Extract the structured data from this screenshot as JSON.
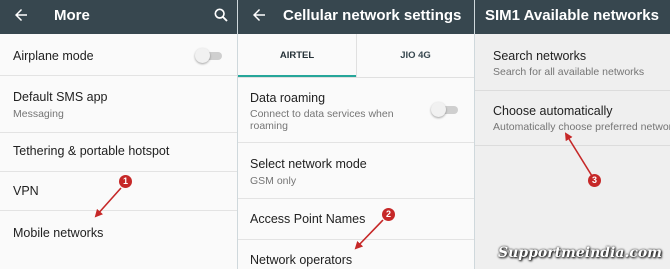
{
  "screen1": {
    "title": "More",
    "airplane_label": "Airplane mode",
    "sms_label": "Default SMS app",
    "sms_value": "Messaging",
    "tethering_label": "Tethering & portable hotspot",
    "vpn_label": "VPN",
    "mobile_label": "Mobile networks",
    "callout": "1"
  },
  "screen2": {
    "title": "Cellular network settings",
    "tabs": [
      {
        "label": "AIRTEL",
        "active": true
      },
      {
        "label": "JIO 4G",
        "active": false
      }
    ],
    "roaming_label": "Data roaming",
    "roaming_sub_1": "Connect to data services when",
    "roaming_sub_2": "roaming",
    "mode_label": "Select network mode",
    "mode_value": "GSM only",
    "apn_label": "Access Point Names",
    "operators_label": "Network operators",
    "callout": "2"
  },
  "screen3": {
    "title": "SIM1 Available networks",
    "search_label": "Search networks",
    "search_sub": "Search for all available networks",
    "auto_label": "Choose automatically",
    "auto_sub": "Automatically choose preferred network",
    "callout": "3"
  },
  "watermark": "Supportmeindia.com",
  "colors": {
    "toolbar": "#37474f",
    "accent": "#26a69a",
    "arrow": "#c62828"
  },
  "icons": [
    "back-arrow-icon",
    "search-icon",
    "toggle-switch"
  ]
}
